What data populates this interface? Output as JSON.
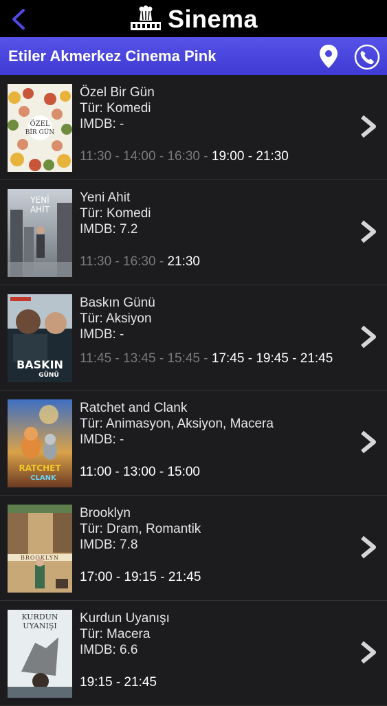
{
  "header": {
    "title": "Sinema",
    "back_icon": "chevron-left-icon",
    "logo_icon": "popcorn-film-icon"
  },
  "cinema": {
    "name": "Etiler Akmerkez Cinema Pink",
    "map_icon": "location-pin-icon",
    "call_icon": "phone-icon",
    "accent": "#4a46de"
  },
  "movies": [
    {
      "title": "Özel Bir Gün",
      "genre": "Tür: Komedi",
      "imdb": "IMDB: -",
      "past": "11:30 - 14:00 - 16:30 - ",
      "upcoming": "19:00 - 21:30",
      "poster_text": "ÖZEL BİR GÜN"
    },
    {
      "title": "Yeni Ahit",
      "genre": "Tür: Komedi",
      "imdb": "IMDB: 7.2",
      "past": "11:30 - 16:30 - ",
      "upcoming": "21:30",
      "poster_text": "YENİ AHİT"
    },
    {
      "title": "Baskın Günü",
      "genre": "Tür: Aksiyon",
      "imdb": "IMDB: -",
      "past": "11:45 - 13:45 - 15:45 - ",
      "upcoming": "17:45 - 19:45 - 21:45",
      "poster_text": "BASKIN GÜNÜ"
    },
    {
      "title": "Ratchet and Clank",
      "genre": "Tür: Animasyon, Aksiyon, Macera",
      "imdb": "IMDB: -",
      "past": "",
      "upcoming": "11:00 - 13:00 - 15:00",
      "poster_text": "RATCHET CLANK"
    },
    {
      "title": "Brooklyn",
      "genre": "Tür: Dram, Romantik",
      "imdb": "IMDB: 7.8",
      "past": "",
      "upcoming": "17:00 - 19:15 - 21:45",
      "poster_text": "BROOKLYN"
    },
    {
      "title": "Kurdun Uyanışı",
      "genre": "Tür: Macera",
      "imdb": "IMDB: 6.6",
      "past": "",
      "upcoming": "19:15 - 21:45",
      "poster_text": "KURDUN UYANIŞI"
    }
  ]
}
